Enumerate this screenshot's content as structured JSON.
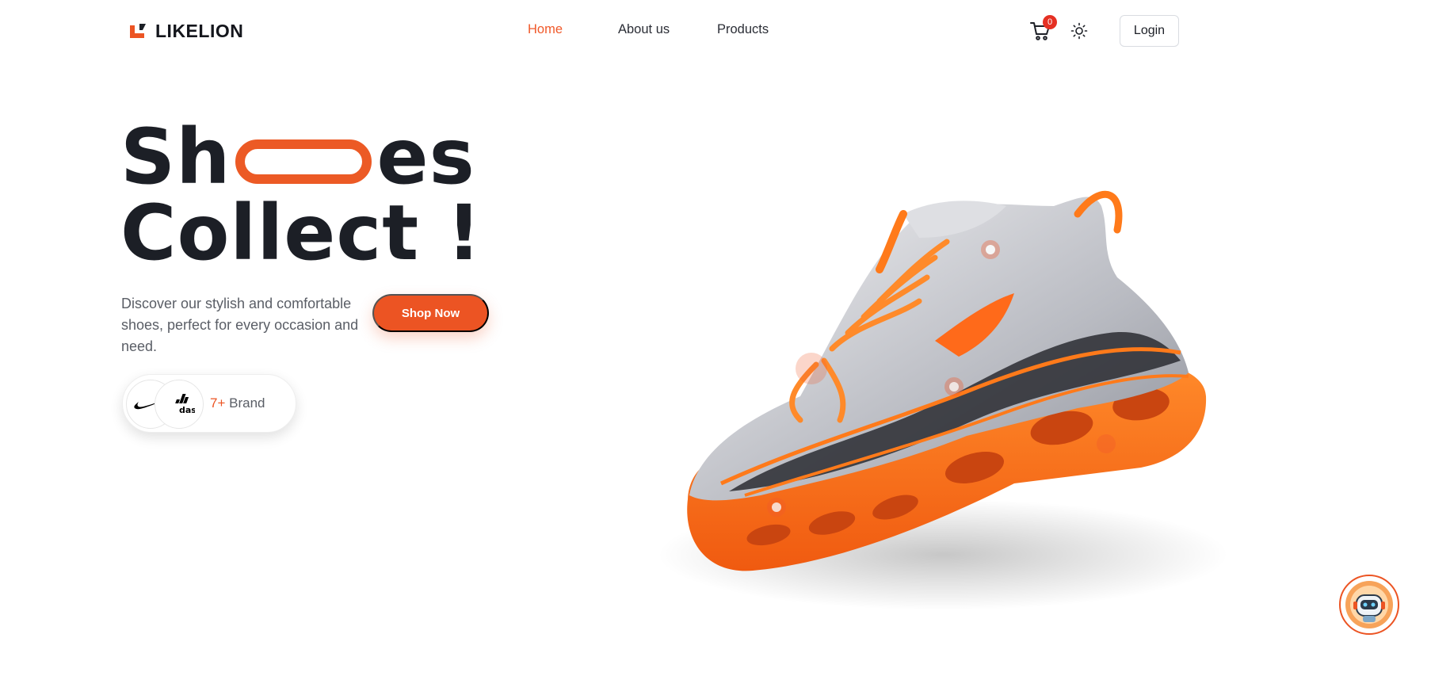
{
  "brand": {
    "name": "LIKELION"
  },
  "nav": {
    "home": "Home",
    "about": "About us",
    "products": "Products"
  },
  "cart": {
    "count": "0"
  },
  "login": {
    "label": "Login"
  },
  "hero": {
    "title_part1": "Sh",
    "title_part2": "es",
    "title_line2": "Collect !",
    "description": "Discover our stylish and comfortable shoes, perfect for every occasion and need.",
    "cta": "Shop Now"
  },
  "brands": {
    "count": "7+",
    "label": "Brand",
    "logos": [
      "nike-logo",
      "adidas-logo"
    ]
  },
  "colors": {
    "accent": "#ec5423",
    "text": "#1c1f26",
    "muted": "#5a5e66",
    "badge": "#e53023"
  },
  "icons": [
    "cart-icon",
    "sun-icon",
    "chatbot-icon"
  ]
}
